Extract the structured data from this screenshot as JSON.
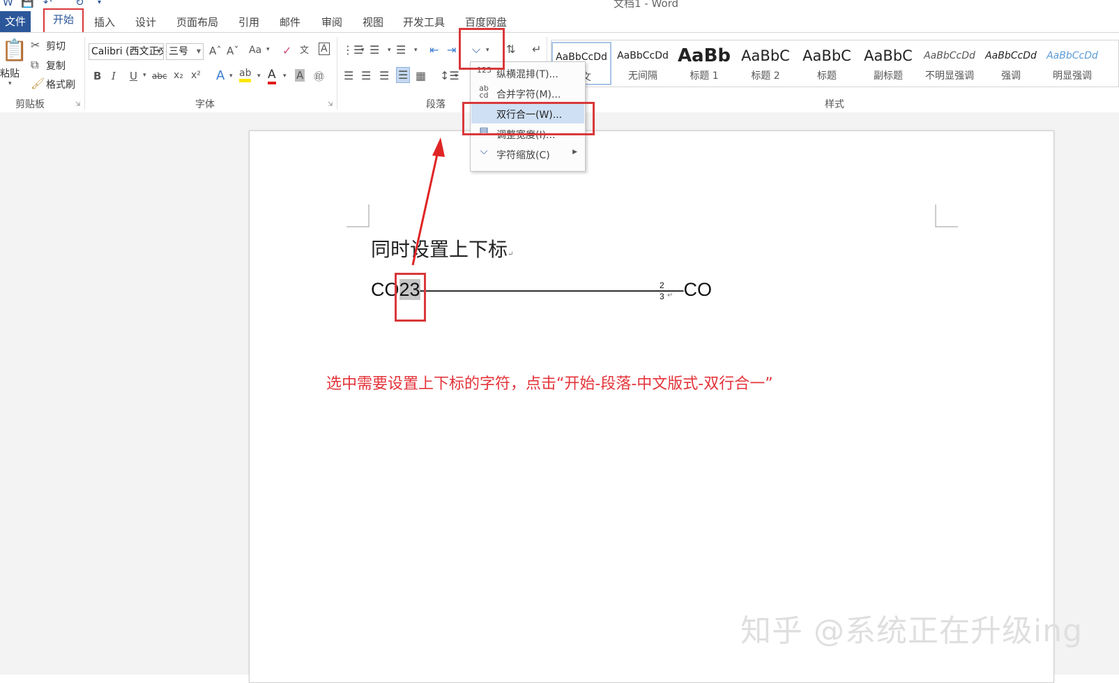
{
  "window": {
    "title": "文档1 - Word"
  },
  "tabs": {
    "file": "文件",
    "home": "开始",
    "others": [
      "插入",
      "设计",
      "页面布局",
      "引用",
      "邮件",
      "审阅",
      "视图",
      "开发工具",
      "百度网盘"
    ]
  },
  "ribbon": {
    "clipboard": {
      "paste": "粘贴",
      "cut": "剪切",
      "copy": "复制",
      "format_painter": "格式刷",
      "group_label": "剪贴板"
    },
    "font": {
      "name": "Calibri (西文正文)",
      "size": "三号",
      "group_label": "字体",
      "bold": "B",
      "italic": "I",
      "underline": "U",
      "strike": "abc",
      "subscript": "x₂",
      "superscript": "x²",
      "change_case": "Aa"
    },
    "paragraph": {
      "group_label": "段落"
    },
    "styles": {
      "group_label": "样式",
      "items": [
        {
          "preview": "AaBbCcDd",
          "name": "正文"
        },
        {
          "preview": "AaBbCcDd",
          "name": "无间隔"
        },
        {
          "preview": "AaBb",
          "name": "标题 1"
        },
        {
          "preview": "AaBbC",
          "name": "标题 2"
        },
        {
          "preview": "AaBbC",
          "name": "标题"
        },
        {
          "preview": "AaBbC",
          "name": "副标题"
        },
        {
          "preview": "AaBbCcDd",
          "name": "不明显强调"
        },
        {
          "preview": "AaBbCcDd",
          "name": "强调"
        },
        {
          "preview": "AaBbCcDd",
          "name": "明显强调"
        }
      ]
    }
  },
  "menu": {
    "items": [
      {
        "icon": "123",
        "label": "纵横混排(T)..."
      },
      {
        "icon": "ab cd",
        "label": "合并字符(M)..."
      },
      {
        "icon": "",
        "label": "双行合一(W)..."
      },
      {
        "icon": "",
        "label": "调整宽度(I)..."
      },
      {
        "icon": "",
        "label": "字符缩放(C)"
      }
    ]
  },
  "document": {
    "heading": "同时设置上下标",
    "formula_prefix": "CO",
    "selected_chars": "23",
    "dashes": "——————————————",
    "co3_base": "CO",
    "co3_sup": "2",
    "co3_sub": "3",
    "para_mark": "↵"
  },
  "annotation": "选中需要设置上下标的字符，点击“开始-段落-中文版式-双行合一”",
  "watermark": "知乎 @系统正在升级ing",
  "colors": {
    "accent": "#2b579a",
    "highlight_box": "#d9383a",
    "annotation_text": "#e3343a"
  }
}
